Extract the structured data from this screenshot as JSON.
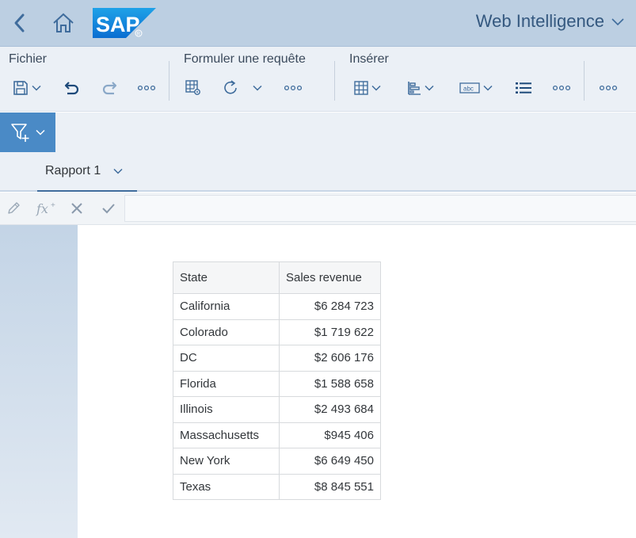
{
  "shell": {
    "logo_text": "SAP",
    "app_title": "Web Intelligence"
  },
  "toolbar": {
    "groups": [
      {
        "label": "Fichier"
      },
      {
        "label": "Formuler une requête"
      },
      {
        "label": "Insérer"
      }
    ]
  },
  "tabs": [
    {
      "label": "Rapport 1",
      "selected": true
    }
  ],
  "formula_bar": {
    "value": ""
  },
  "table": {
    "headers": [
      "State",
      "Sales revenue"
    ],
    "rows": [
      {
        "state": "California",
        "revenue": "$6 284 723"
      },
      {
        "state": "Colorado",
        "revenue": "$1 719 622"
      },
      {
        "state": "DC",
        "revenue": "$2 606 176"
      },
      {
        "state": "Florida",
        "revenue": "$1 588 658"
      },
      {
        "state": "Illinois",
        "revenue": "$2 493 684"
      },
      {
        "state": "Massachusetts",
        "revenue": "$945 406"
      },
      {
        "state": "New York",
        "revenue": "$6 649 450"
      },
      {
        "state": "Texas",
        "revenue": "$8 845 551"
      }
    ]
  },
  "colors": {
    "shell_bg": "#bccfe2",
    "toolbar_bg": "#ebf0f6",
    "accent": "#4a8ac6",
    "icon": "#3f6c9c"
  }
}
